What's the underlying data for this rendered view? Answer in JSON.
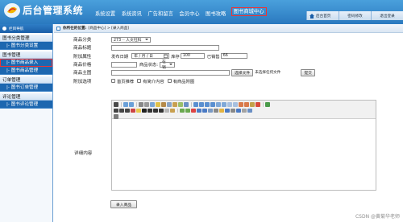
{
  "header": {
    "title": "后台管理系统",
    "nav": [
      "系统设置",
      "系统资讯",
      "广告和留言",
      "会员中心",
      "图书攻略",
      "图书商城中心"
    ],
    "active_nav_index": 5,
    "right_buttons": [
      "后台首页",
      "密码修改",
      "退出登录"
    ]
  },
  "sidebar": {
    "header_label": "栏目导航",
    "groups": [
      {
        "label": "图书分类管理",
        "items": [
          "|- 图书分类设置"
        ]
      },
      {
        "label": "图书管理",
        "items": [
          "|- 图书商品录入",
          "|- 图书商品管理"
        ]
      },
      {
        "label": "订单管理",
        "items": [
          "|- 图书订单管理"
        ]
      },
      {
        "label": "评论管理",
        "items": [
          "|- 图书评论管理"
        ]
      }
    ],
    "active_item": "|- 图书商品录入"
  },
  "breadcrumb": {
    "lead": "你所在的位置:",
    "path": "[商品中心] > [录入商品]"
  },
  "form": {
    "category_label": "商品分类",
    "category_value": "273 ·· 人文社科",
    "title_label": "商品标题",
    "title_value": "",
    "attr_label": "附加属性",
    "publish_label": "发布日期",
    "publish_value": "年 / 月 / 日",
    "stock_label": "库存",
    "stock_value": "100",
    "sold_label": "已销售",
    "sold_value": "66",
    "price_label": "商品价格",
    "price_value": "",
    "status_label": "商品状态:",
    "status_value": "在销",
    "image_label": "商品主图",
    "choose_file_label": "选择文件",
    "no_file_label": "未选择任何文件",
    "upload_label": "提交",
    "options_label": "附加选项",
    "options": [
      "首页推荐",
      "有简介内容",
      "有商品附图"
    ],
    "detail_label": "详细内容",
    "submit_label": "录入商品"
  },
  "watermark": "CSDN @黄菊华老师",
  "colors": {
    "header": "#2a79bf",
    "sidebar_sub": "#1d67b0",
    "highlight": "#ee3333"
  }
}
